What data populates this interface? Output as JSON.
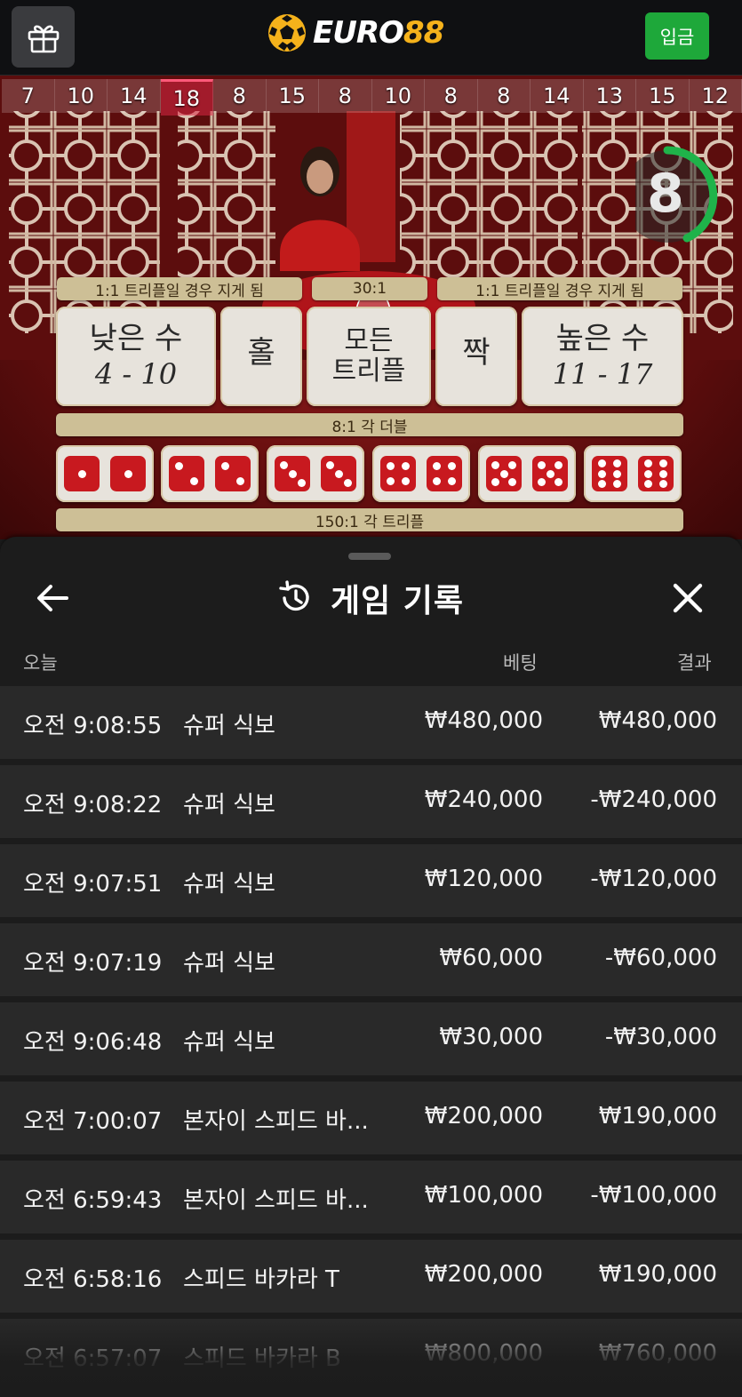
{
  "header": {
    "logo_text_a": "EURO",
    "logo_text_b": "88",
    "deposit_label": "입금",
    "gift_icon": "gift-icon",
    "colors": {
      "deposit": "#1ea83a",
      "logo_accent": "#f5b21b"
    }
  },
  "game": {
    "recent_results": [
      "7",
      "10",
      "14",
      "18",
      "8",
      "15",
      "8",
      "10",
      "8",
      "8",
      "14",
      "13",
      "15",
      "12"
    ],
    "timer_value": "8",
    "timer_progress": 0.55,
    "payout_left": "1:1 트리플일 경우 지게 됨",
    "payout_mid": "30:1",
    "payout_right": "1:1 트리플일 경우 지게 됨",
    "bets": {
      "low_label": "낮은 수",
      "low_range": "4 - 10",
      "odd_label": "홀",
      "any_triple_label_1": "모든",
      "any_triple_label_2": "트리플",
      "even_label": "짝",
      "high_label": "높은 수",
      "high_range": "11 - 17"
    },
    "doubles_payout": "8:1 각 더블",
    "triples_payout": "150:1 각 트리플",
    "double_faces": [
      1,
      2,
      3,
      4,
      5,
      6
    ]
  },
  "history": {
    "title": "게임 기록",
    "history_icon": "history-icon",
    "columns": {
      "date": "오늘",
      "bet": "베팅",
      "result": "결과"
    },
    "rows": [
      {
        "time": "오전 9:08:55",
        "game": "슈퍼 식보",
        "bet": "₩480,000",
        "result": "₩480,000"
      },
      {
        "time": "오전 9:08:22",
        "game": "슈퍼 식보",
        "bet": "₩240,000",
        "result": "-₩240,000"
      },
      {
        "time": "오전 9:07:51",
        "game": "슈퍼 식보",
        "bet": "₩120,000",
        "result": "-₩120,000"
      },
      {
        "time": "오전 9:07:19",
        "game": "슈퍼 식보",
        "bet": "₩60,000",
        "result": "-₩60,000"
      },
      {
        "time": "오전 9:06:48",
        "game": "슈퍼 식보",
        "bet": "₩30,000",
        "result": "-₩30,000"
      },
      {
        "time": "오전 7:00:07",
        "game": "본자이 스피드 바...",
        "bet": "₩200,000",
        "result": "₩190,000"
      },
      {
        "time": "오전 6:59:43",
        "game": "본자이 스피드 바...",
        "bet": "₩100,000",
        "result": "-₩100,000"
      },
      {
        "time": "오전 6:58:16",
        "game": "스피드 바카라 T",
        "bet": "₩200,000",
        "result": "₩190,000"
      },
      {
        "time": "오전 6:57:07",
        "game": "스피드 바카라 B",
        "bet": "₩800,000",
        "result": "₩760,000"
      }
    ]
  }
}
